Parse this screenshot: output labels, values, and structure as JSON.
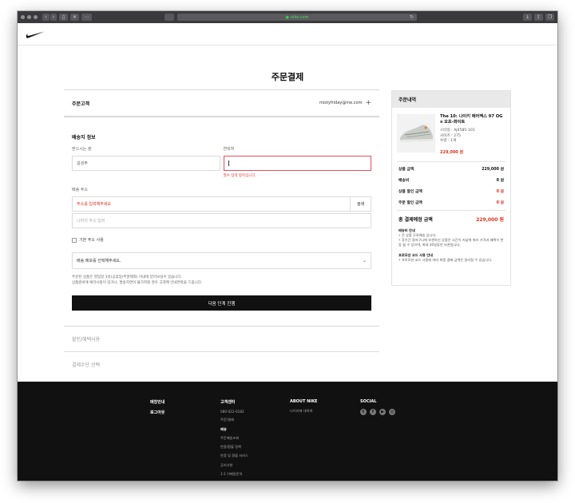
{
  "browser": {
    "url": "nike.com"
  },
  "page": {
    "title": "주문결제"
  },
  "customer": {
    "label": "주문고객",
    "email": "mistyfriday@me.com"
  },
  "shipping": {
    "title": "배송지 정보",
    "recipient_label": "받으시는 분",
    "recipient_value": "김성주",
    "phone_label": "연락처",
    "phone_error": "필수 입력 항목입니다.",
    "address_label": "배송 주소",
    "address_placeholder": "주소를 입력해주세요",
    "search_button": "검색",
    "detail_placeholder": "나머지 주소 입력",
    "default_address_label": "기본 주소 사용",
    "memo_select": "배송 메모를 선택해주세요.",
    "notice_line1": "주문된 상품은 영업일 3일(공휴일/주말제외) 이내에 받아보실수 있습니다.",
    "notice_line2": "상품준비에 에러사항이 있거나, 발송지연이 불가피할 경우 고객께 안내연락을 드립니다.",
    "next_button": "다음 단계 진행"
  },
  "sections": {
    "discount": "할인/혜택사용",
    "payment": "결제수단 선택"
  },
  "summary": {
    "title": "주문내역",
    "product_name": "The 10: 나이키 에어맥스 97 OG x 오프-화이트",
    "style": "스타일 : AJ4585-101",
    "size": "사이즈 : 275",
    "qty": "수량 : 1개",
    "price": "229,000 원",
    "rows": [
      {
        "label": "상품 금액",
        "value": "229,000 원"
      },
      {
        "label": "배송비",
        "value": "0 원"
      },
      {
        "label": "상품 할인 금액",
        "value": "0 원"
      },
      {
        "label": "주문 할인 금액",
        "value": "0 원"
      }
    ],
    "total_label": "총 결제예정 금액",
    "total_value": "229,000 원",
    "ship_info_title": "배송비 안내",
    "ship_info_1": "전 상품 무료배송 입니다.",
    "ship_info_2": "장기간 장바구니에 보관하신 상품은 시간이 지남에 따라 가격과 혜택이 변동 될 수 있으며, 최대 30일동안 보관됩니다.",
    "promo_title": "프로모션 코드 사용 안내",
    "promo_1": "프로모션 코드 사용에 따라 최종 결제 금액은 달라질 수 있습니다."
  },
  "footer": {
    "col1": [
      "매장안내",
      "로그아웃"
    ],
    "col2_title": "고객센터",
    "col2": [
      "080-022-0182",
      "주문/결제",
      "배송",
      "주문배송조회",
      "반품/환불 정책",
      "반품 및 환불 서비스",
      "공지사항",
      "1:1 이메일문의",
      "이용약관",
      "개인정보처리방침"
    ],
    "col3_title": "ABOUT NIKE",
    "col3": [
      "나이키에 대하여"
    ],
    "col4_title": "SOCIAL"
  },
  "colors": {
    "error": "#e0301e",
    "dark": "#111111"
  }
}
